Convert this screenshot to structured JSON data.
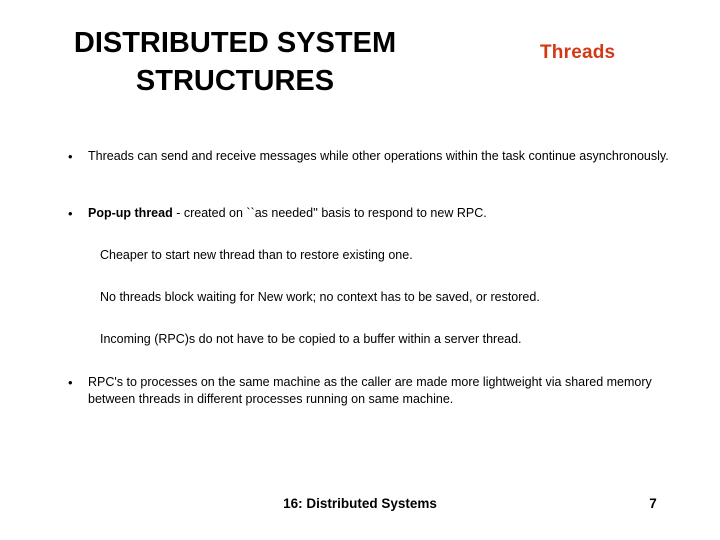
{
  "slide": {
    "title_lines": [
      "DISTRIBUTED SYSTEM",
      "STRUCTURES"
    ],
    "topic_label": "Threads",
    "topic_color": "#d13a14",
    "background_color": "#ffffff",
    "text_color": "#000000"
  },
  "content": {
    "bullets": [
      {
        "marker": "•",
        "line1": "Threads can send and receive messages while other operations within the task",
        "line2": "continue asynchronously."
      },
      {
        "marker": "•",
        "lead_bold": "Pop-up thread",
        "rest": " - created on ``as needed'' basis to respond to new  RPC."
      },
      {
        "marker": "•",
        "line1": "RPC's to processes on the same machine as the caller are made more lightweight via",
        "line2": "shared memory between threads in different processes running on same machine."
      }
    ],
    "sub_lines": [
      "Cheaper to start new thread than to restore existing one.",
      "No threads block waiting for New work; no context has to be saved, or restored.",
      "Incoming (RPC)s do not have to be copied to a buffer within a server thread."
    ]
  },
  "footer": {
    "title": "16: Distributed Systems",
    "page_number": "7"
  }
}
